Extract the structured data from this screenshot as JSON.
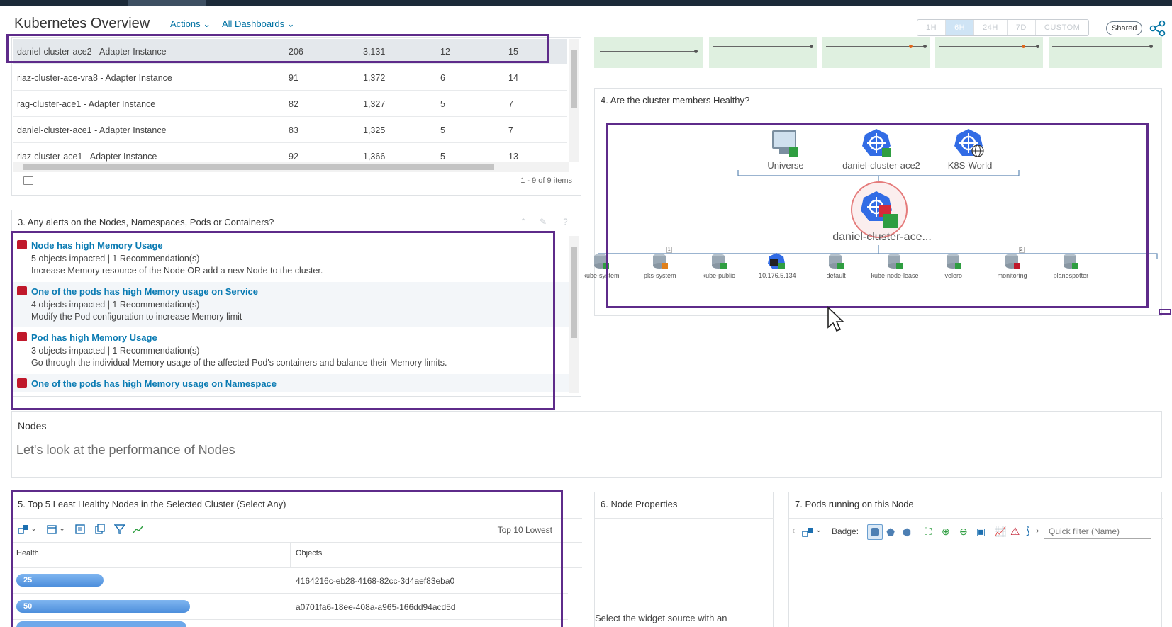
{
  "header": {
    "title": "Kubernetes Overview",
    "actions_label": "Actions",
    "all_dashboards_label": "All Dashboards",
    "time_ranges": [
      "1H",
      "6H",
      "24H",
      "7D",
      "CUSTOM"
    ],
    "active_time_range": "6H",
    "shared_label": "Shared"
  },
  "adapter_table": {
    "rows": [
      {
        "name": "daniel-cluster-ace2 - Adapter Instance",
        "c1": "206",
        "c2": "3,131",
        "c3": "12",
        "c4": "15"
      },
      {
        "name": "riaz-cluster-ace-vra8 - Adapter Instance",
        "c1": "91",
        "c2": "1,372",
        "c3": "6",
        "c4": "14"
      },
      {
        "name": "rag-cluster-ace1 - Adapter Instance",
        "c1": "82",
        "c2": "1,327",
        "c3": "5",
        "c4": "7"
      },
      {
        "name": "daniel-cluster-ace1 - Adapter Instance",
        "c1": "83",
        "c2": "1,325",
        "c3": "5",
        "c4": "7"
      },
      {
        "name": "riaz-cluster-ace1 - Adapter Instance",
        "c1": "92",
        "c2": "1,366",
        "c3": "5",
        "c4": "13"
      }
    ],
    "pagination": "1 - 9 of 9 items"
  },
  "alerts_panel": {
    "title": "3. Any alerts on the Nodes, Namespaces, Pods or Containers?",
    "alerts": [
      {
        "title": "Node has high Memory Usage",
        "impact": "5 objects impacted | 1 Recommendation(s)",
        "recommendation": "Increase Memory resource of the Node OR add a new Node to the cluster."
      },
      {
        "title": "One of the pods has high Memory usage on Service",
        "impact": "4 objects impacted | 1 Recommendation(s)",
        "recommendation": "Modify the Pod configuration to increase Memory limit"
      },
      {
        "title": "Pod has high Memory Usage",
        "impact": "3 objects impacted | 1 Recommendation(s)",
        "recommendation": "Go through the individual Memory usage of the affected Pod's containers and balance their Memory limits."
      },
      {
        "title": "One of the pods has high Memory usage on Namespace",
        "impact": "",
        "recommendation": ""
      }
    ]
  },
  "health_panel": {
    "title": "4. Are the cluster members Healthy?",
    "parents": [
      "Universe",
      "daniel-cluster-ace2",
      "K8S-World"
    ],
    "center": "daniel-cluster-ace...",
    "children": [
      "kube-system",
      "pks-system",
      "kube-public",
      "10.176.5.134",
      "default",
      "kube-node-lease",
      "velero",
      "monitoring",
      "planespotter"
    ],
    "child_badges": {
      "pks-system": "1",
      "monitoring": "2"
    }
  },
  "nodes_section": {
    "heading": "Nodes",
    "subheading": "Let's look at the performance of Nodes"
  },
  "least_healthy": {
    "title": "5. Top 5 Least Healthy Nodes in the Selected Cluster (Select Any)",
    "toolbar_right": "Top 10 Lowest",
    "col_health": "Health",
    "col_objects": "Objects",
    "rows": [
      {
        "health": "25",
        "health_value": 25,
        "object": "4164216c-eb28-4168-82cc-3d4aef83eba0"
      },
      {
        "health": "50",
        "health_value": 50,
        "object": "a0701fa6-18ee-408a-a965-166dd94acd5d"
      }
    ]
  },
  "node_properties": {
    "title": "6. Node Properties",
    "message": "Select the widget source with an"
  },
  "pods_panel": {
    "title": "7. Pods running on this Node",
    "badge_label": "Badge:",
    "filter_placeholder": "Quick filter (Name)"
  },
  "colors": {
    "accent": "#0072a3",
    "highlight": "#5e2b8a",
    "critical": "#c0182b",
    "health_bar": "#4d8fdc"
  }
}
